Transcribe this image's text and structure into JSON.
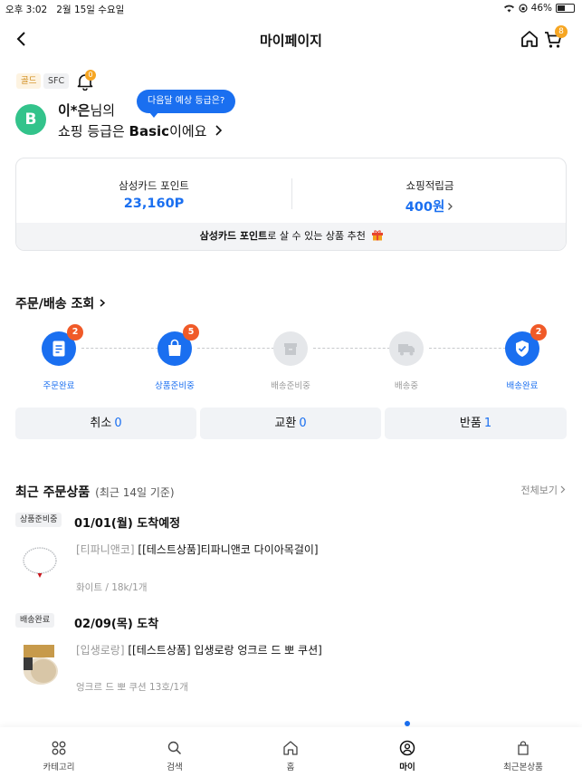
{
  "status_bar": {
    "time": "오후 3:02",
    "date": "2월 15일 수요일",
    "battery": "46%"
  },
  "header": {
    "title": "마이페이지",
    "cart_count": "8"
  },
  "profile": {
    "tags": [
      "골드",
      "SFC"
    ],
    "notification_count": "0",
    "tooltip": "다음달 예상 등급은?",
    "avatar_letter": "B",
    "name": "이*은",
    "name_suffix": "님의",
    "grade_prefix": "쇼핑 등급은 ",
    "grade": "Basic",
    "grade_suffix": "이에요"
  },
  "points": {
    "card_point_label": "삼성카드 포인트",
    "card_point_value": "23,160P",
    "shopping_point_label": "쇼핑적립금",
    "shopping_point_value": "400원",
    "recommend_bold": "삼성카드 포인트",
    "recommend_rest": "로 살 수 있는 상품 추천"
  },
  "orders": {
    "title": "주문/배송 조회",
    "steps": [
      {
        "label": "주문완료",
        "count": "2",
        "active": true
      },
      {
        "label": "상품준비중",
        "count": "5",
        "active": true
      },
      {
        "label": "배송준비중",
        "count": "",
        "active": false
      },
      {
        "label": "배송중",
        "count": "",
        "active": false
      },
      {
        "label": "배송완료",
        "count": "2",
        "active": true
      }
    ],
    "claims": [
      {
        "label": "취소",
        "count": "0"
      },
      {
        "label": "교환",
        "count": "0"
      },
      {
        "label": "반품",
        "count": "1"
      }
    ]
  },
  "recent": {
    "title": "최근 주문상품",
    "subtitle": "(최근 14일 기준)",
    "view_all": "전체보기",
    "items": [
      {
        "status": "상품준비중",
        "arrival": "01/01(월) 도착예정",
        "brand": "[티파니앤코]",
        "name": "[[테스트상품]티파니앤코 다이아목걸이]",
        "option": "화이트 / 18k/1개"
      },
      {
        "status": "배송완료",
        "arrival": "02/09(목) 도착",
        "brand": "[입생로랑]",
        "name": "[[테스트상품] 입생로랑 엉크르 드 뽀 쿠션]",
        "option": "엉크르 드 뽀 쿠션 13호/1개"
      }
    ]
  },
  "tabbar": {
    "tabs": [
      "카테고리",
      "검색",
      "홈",
      "마이",
      "최근본상품"
    ],
    "selected": "마이"
  },
  "colors": {
    "accent": "#1a6ff0",
    "badge": "#f05a28",
    "avatar": "#33c38b"
  }
}
